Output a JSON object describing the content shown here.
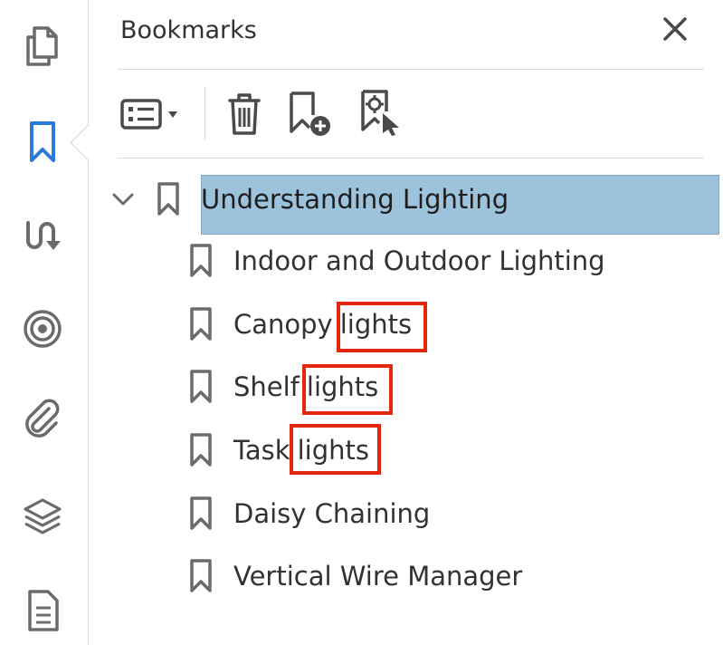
{
  "rail": {
    "items": [
      {
        "name": "pages-icon",
        "active": false
      },
      {
        "name": "bookmark-icon",
        "active": true
      },
      {
        "name": "reading-order-icon",
        "active": false
      },
      {
        "name": "target-icon",
        "active": false
      },
      {
        "name": "attachment-icon",
        "active": false
      },
      {
        "name": "layers-icon",
        "active": false
      },
      {
        "name": "document-icon",
        "active": false
      }
    ]
  },
  "panel": {
    "title": "Bookmarks",
    "close_icon": "close-icon"
  },
  "toolbar": {
    "items": [
      {
        "name": "options-menu-icon"
      },
      {
        "name": "delete-icon"
      },
      {
        "name": "new-bookmark-icon"
      },
      {
        "name": "find-current-bookmark-icon"
      }
    ]
  },
  "bookmarks": {
    "parent": {
      "label": "Understanding Lighting",
      "expanded": true,
      "selected": true
    },
    "children": [
      {
        "label": "Indoor and Outdoor Lighting"
      },
      {
        "prefix": "Canopy",
        "match": "lights"
      },
      {
        "prefix": "Shelf",
        "match": "lights"
      },
      {
        "prefix": "Task",
        "match": "lights"
      },
      {
        "label": "Daisy Chaining"
      },
      {
        "label": "Vertical Wire Manager"
      }
    ]
  },
  "colors": {
    "accent": "#2b7ad8",
    "icon": "#6b6b6b",
    "selection": "#9dc3dc",
    "highlight": "#e5260f"
  }
}
